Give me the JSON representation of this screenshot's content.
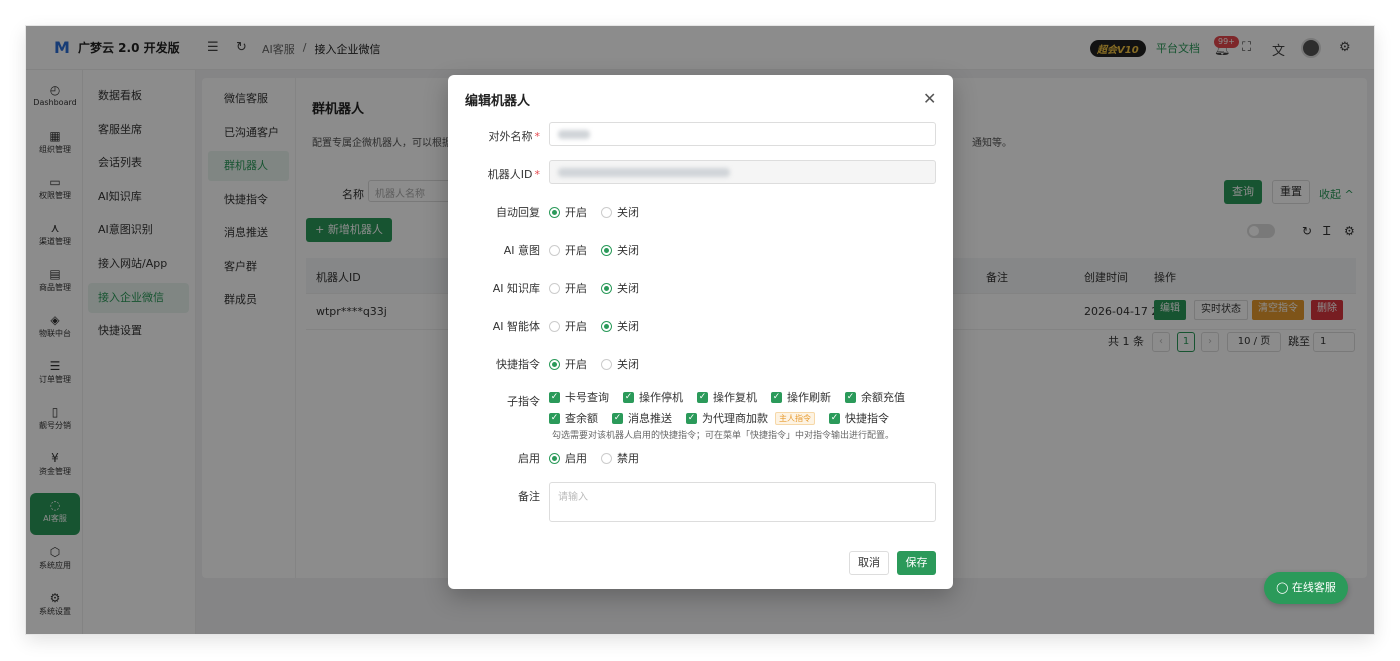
{
  "header": {
    "logo_text": "广梦云 2.0 开发版",
    "breadcrumb": [
      "AI客服",
      "接入企业微信"
    ],
    "breadcrumb_sep": "/",
    "vip_badge": "超会V10",
    "docs_link": "平台文档",
    "notification_count": "99+"
  },
  "rail": {
    "items": [
      {
        "label": "Dashboard",
        "icon": "dashboard-icon",
        "glyph": "◴"
      },
      {
        "label": "组织管理",
        "icon": "org-icon",
        "glyph": "▦"
      },
      {
        "label": "权限管理",
        "icon": "monitor-icon",
        "glyph": "▭"
      },
      {
        "label": "渠道管理",
        "icon": "channel-icon",
        "glyph": "⋏"
      },
      {
        "label": "商品管理",
        "icon": "product-icon",
        "glyph": "▤"
      },
      {
        "label": "物联中台",
        "icon": "iot-icon",
        "glyph": "◈"
      },
      {
        "label": "订单管理",
        "icon": "order-icon",
        "glyph": "☰"
      },
      {
        "label": "靓号分销",
        "icon": "phone-icon",
        "glyph": "▯"
      },
      {
        "label": "资金管理",
        "icon": "fund-icon",
        "glyph": "¥"
      },
      {
        "label": "AI客服",
        "icon": "ai-service-icon",
        "glyph": "◌"
      },
      {
        "label": "系统应用",
        "icon": "app-icon",
        "glyph": "⬡"
      },
      {
        "label": "系统设置",
        "icon": "settings-icon",
        "glyph": "⚙"
      }
    ],
    "active_index": 9
  },
  "submenu": {
    "items": [
      "数据看板",
      "客服坐席",
      "会话列表",
      "AI知识库",
      "AI意图识别",
      "接入网站/App",
      "接入企业微信",
      "快捷设置"
    ],
    "active_index": 6
  },
  "tabs": {
    "items": [
      "微信客服",
      "已沟通客户",
      "群机器人",
      "快捷指令",
      "消息推送",
      "客户群",
      "群成员"
    ],
    "active_index": 2
  },
  "main": {
    "title": "群机器人",
    "description": "配置专属企微机器人，可以根据",
    "description_tail": "通知等。",
    "filter_label": "名称",
    "filter_placeholder": "机器人名称",
    "search_button": "查询",
    "reset_button": "重置",
    "collapse_link": "收起 ^",
    "add_button": "+ 新增机器人"
  },
  "table": {
    "columns": {
      "robot_id": "机器人ID",
      "remark": "备注",
      "created": "创建时间",
      "actions": "操作"
    },
    "rows": [
      {
        "robot_id": "wtpr****q33j",
        "created": "2026-04-17 2"
      }
    ],
    "row_actions": {
      "edit": "编辑",
      "status": "实时状态",
      "clear": "清空指令",
      "delete": "删除"
    },
    "colors": {
      "edit": "#2b9a5a",
      "clear": "#e69a2e",
      "delete": "#d9363e"
    }
  },
  "pagination": {
    "total_text": "共 1 条",
    "current_page": "1",
    "page_size": "10 / 页",
    "jump_label": "跳至",
    "jump_value": "1"
  },
  "float_button": "在线客服",
  "modal": {
    "title": "编辑机器人",
    "fields": {
      "name_label": "对外名称",
      "id_label": "机器人ID",
      "auto_reply_label": "自动回复",
      "ai_intent_label": "AI 意图",
      "ai_kb_label": "AI 知识库",
      "ai_agent_label": "AI 智能体",
      "shortcut_label": "快捷指令",
      "sub_cmd_label": "子指令",
      "enable_label": "启用",
      "remark_label": "备注"
    },
    "radio": {
      "on": "开启",
      "off": "关闭",
      "enable": "启用",
      "disable": "禁用"
    },
    "selections": {
      "auto_reply": "开启",
      "ai_intent": "关闭",
      "ai_kb": "关闭",
      "ai_agent": "关闭",
      "shortcut": "开启",
      "enable": "启用"
    },
    "sub_commands_row1": [
      "卡号查询",
      "操作停机",
      "操作复机",
      "操作刷新",
      "余额充值"
    ],
    "sub_commands_row2": [
      "查余额",
      "消息推送",
      "为代理商加款",
      "快捷指令"
    ],
    "owner_tag": "主人指令",
    "hint": "勾选需要对该机器人启用的快捷指令；可在菜单「快捷指令」中对指令输出进行配置。",
    "remark_placeholder": "请输入",
    "cancel": "取消",
    "save": "保存"
  },
  "colors": {
    "brand": "#2b9a5a",
    "danger": "#e5484d"
  }
}
